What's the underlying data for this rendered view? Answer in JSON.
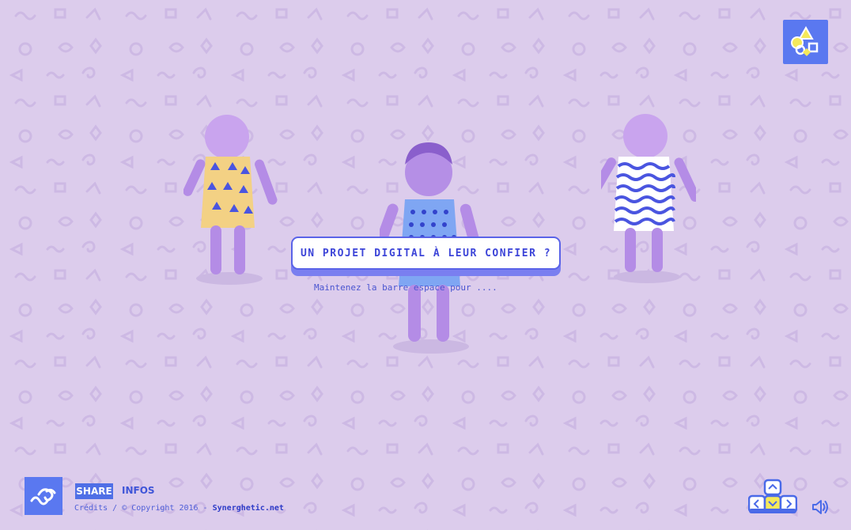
{
  "cta": {
    "label": "UN PROJET DIGITAL À LEUR CONFIER ?"
  },
  "hint": {
    "text": "Maintenez la barre espace pour ...."
  },
  "footer": {
    "share_label": "SHARE",
    "infos_label": "INFOS",
    "credits_prefix": "Crédits / © Copyright 2016 - ",
    "credits_site": "Synerghetic.net"
  },
  "colors": {
    "background": "#dcccec",
    "accent_blue": "#5a78f0",
    "button_text": "#3d45d8",
    "baby_tint": "#b48ce6"
  },
  "icons": {
    "top_logo": "shapes-logo-icon",
    "bottom_logo": "wave-logo-icon",
    "keys": "arrow-keys-icon",
    "sound": "speaker-icon"
  }
}
